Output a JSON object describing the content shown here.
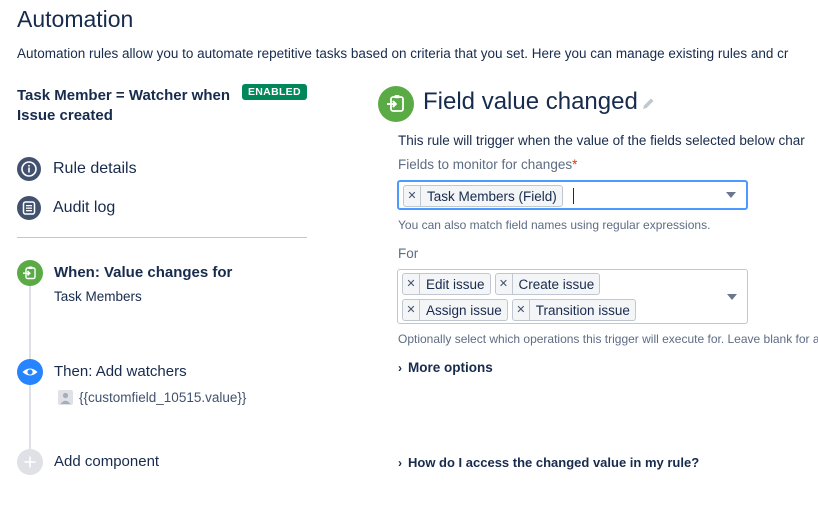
{
  "page": {
    "title": "Automation",
    "description": "Automation rules allow you to automate repetitive tasks based on criteria that you set. Here you can manage existing rules and cr"
  },
  "rule": {
    "name": "Task Member = Watcher when Issue created",
    "status_badge": "ENABLED"
  },
  "nav": {
    "rule_details": "Rule details",
    "audit_log": "Audit log"
  },
  "steps": {
    "when_title": "When: Value changes for",
    "when_sub": "Task Members",
    "then_title": "Then: Add watchers",
    "then_sub": "{{customfield_10515.value}}",
    "add_component": "Add component"
  },
  "trigger": {
    "title": "Field value changed",
    "description": "This rule will trigger when the value of the fields selected below char",
    "fields_label": "Fields to monitor for changes",
    "fields_required_mark": "*",
    "fields_selected": [
      "Task Members (Field)"
    ],
    "fields_help": "You can also match field names using regular expressions.",
    "for_label": "For",
    "operations": [
      "Edit issue",
      "Create issue",
      "Assign issue",
      "Transition issue"
    ],
    "operations_help": "Optionally select which operations this trigger will execute for. Leave blank for a",
    "more_options": "More options",
    "help_link": "How do I access the changed value in my rule?"
  },
  "colors": {
    "enabled_green": "#00875a",
    "trigger_green": "#5aab46",
    "action_blue": "#2684ff",
    "nav_icon": "#42526e",
    "focus_border": "#4c9aff"
  },
  "icons": {
    "rule_details": "info-icon",
    "audit_log": "list-icon",
    "when": "field-change-icon",
    "then": "eye-icon",
    "add": "plus-icon",
    "edit": "pencil-icon"
  }
}
